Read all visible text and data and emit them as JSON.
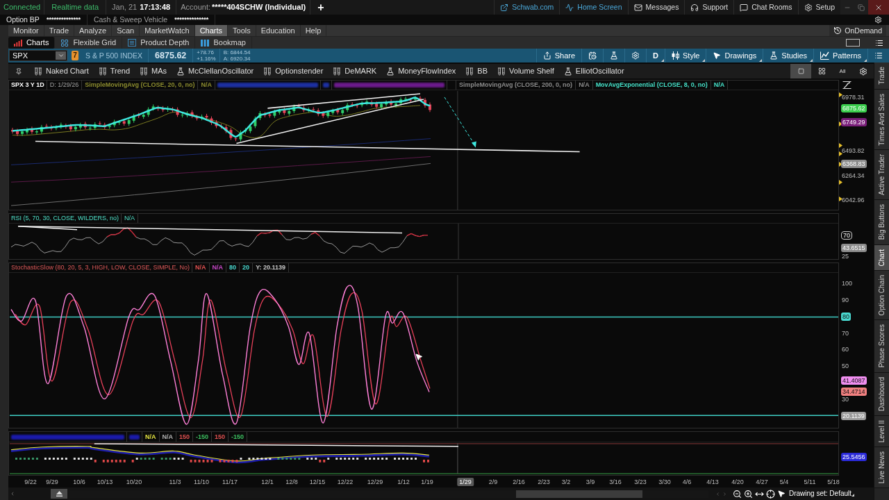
{
  "status_bar": {
    "connection": "Connected",
    "data_feed": "Realtime data",
    "date": "Jan, 21",
    "time": "17:13:48",
    "account_label": "Account:",
    "account": "*****404SCHW (Individual)",
    "add": "+",
    "links": [
      {
        "kind": "external",
        "label": "Schwab.com"
      },
      {
        "kind": "home",
        "label": "Home Screen"
      },
      {
        "kind": "mail",
        "label": "Messages"
      },
      {
        "kind": "support",
        "label": "Support"
      },
      {
        "kind": "chat",
        "label": "Chat Rooms"
      },
      {
        "kind": "setup",
        "label": "Setup"
      }
    ]
  },
  "balances": [
    {
      "label": "Option BP",
      "value": "**************"
    },
    {
      "label": "Cash & Sweep Vehicle",
      "value": "**************"
    }
  ],
  "main_tabs": [
    {
      "label": "Monitor",
      "selected": false
    },
    {
      "label": "Trade",
      "selected": false
    },
    {
      "label": "Analyze",
      "selected": false
    },
    {
      "label": "Scan",
      "selected": false
    },
    {
      "label": "MarketWatch",
      "selected": false
    },
    {
      "label": "Charts",
      "selected": true
    },
    {
      "label": "Tools",
      "selected": false
    },
    {
      "label": "Education",
      "selected": false
    },
    {
      "label": "Help",
      "selected": false
    }
  ],
  "on_demand": "OnDemand",
  "sub_tabs": [
    {
      "kind": "charts",
      "label": "Charts",
      "selected": true
    },
    {
      "kind": "grid",
      "label": "Flexible Grid",
      "selected": false
    },
    {
      "kind": "depth",
      "label": "Product Depth",
      "selected": false
    },
    {
      "kind": "bookmap",
      "label": "Bookmap",
      "selected": false
    }
  ],
  "quote": {
    "symbol": "SPX",
    "alerts": "7",
    "name": "S & P 500 INDEX",
    "last": "6875.62",
    "change": "+78.76",
    "change_percent": "+1.16%",
    "bid": "B: 6844.54",
    "ask": "A: 6920.34"
  },
  "chart_toolbar": [
    {
      "kind": "share",
      "label": "Share"
    },
    {
      "kind": "calendar"
    },
    {
      "kind": "flask"
    },
    {
      "kind": "gear"
    },
    {
      "kind": "text",
      "label": "D"
    },
    {
      "kind": "style",
      "label": "Style"
    },
    {
      "kind": "drawings",
      "label": "Drawings"
    },
    {
      "kind": "studies",
      "label": "Studies"
    },
    {
      "kind": "patterns",
      "label": "Patterns"
    },
    {
      "kind": "menu"
    }
  ],
  "study_sets": [
    {
      "kind": "pin"
    },
    {
      "kind": "tubes",
      "label": "Naked Chart"
    },
    {
      "kind": "tubes",
      "label": "Trend"
    },
    {
      "kind": "tubes",
      "label": "MAs"
    },
    {
      "kind": "flask",
      "label": "McClellanOscillator"
    },
    {
      "kind": "tubes",
      "label": "Optionstender"
    },
    {
      "kind": "tubes",
      "label": "DeMARK"
    },
    {
      "kind": "flask",
      "label": "MoneyFlowIndex"
    },
    {
      "kind": "tubes",
      "label": "BB"
    },
    {
      "kind": "tubes",
      "label": "Volume Shelf"
    },
    {
      "kind": "flask",
      "label": "ElliotOscillator"
    }
  ],
  "layout_buttons": [
    {
      "kind": "single",
      "selected": true
    },
    {
      "kind": "grid",
      "selected": false
    },
    {
      "kind": "all",
      "label": "All",
      "selected": false
    },
    {
      "kind": "settings",
      "selected": false
    }
  ],
  "chart": {
    "title": "SPX 3 Y 1D",
    "date": "D: 1/29/26",
    "studies": [
      {
        "kind": "study",
        "label": "SimpleMovingAvg (CLOSE, 20, 0, no)",
        "value": "N/A",
        "color": "#8c8c2e"
      },
      {
        "kind": "blurred",
        "color": "#1c2fa0"
      },
      {
        "kind": "blurred",
        "color": "#1c2fa0"
      },
      {
        "kind": "blurred",
        "color": "#6a1a8a"
      },
      {
        "kind": "study",
        "label": "SimpleMovingAvg (CLOSE, 200, 0, no)",
        "value": "N/A",
        "color": "#8a8a8a"
      },
      {
        "kind": "study",
        "label": "MovAvgExponential (CLOSE, 8, 0, no)",
        "value": "N/A",
        "color": "#45e0c8"
      }
    ],
    "axis": [
      {
        "text": "6978.31",
        "kind": "plain"
      },
      {
        "text": "6875.62",
        "kind": "badge",
        "color": "#3ccf4e"
      },
      {
        "text": "6749.29",
        "kind": "badge",
        "color": "#7a1f7a"
      },
      {
        "text": "6493.82",
        "kind": "plain"
      },
      {
        "text": "6368.83",
        "kind": "badge",
        "color": "#8c8c8c"
      },
      {
        "text": "6264.34",
        "kind": "plain"
      },
      {
        "text": "6042.96",
        "kind": "plain"
      }
    ]
  },
  "rsi": {
    "label": "RSI (5, 70, 30, CLOSE, WILDERS, no)",
    "value": "N/A",
    "axis": [
      {
        "text": "70",
        "kind": "outlined"
      },
      {
        "text": "43.6515",
        "kind": "badge",
        "color": "#8c8c8c"
      },
      {
        "text": "25",
        "kind": "plain"
      }
    ]
  },
  "stochastic": {
    "label": "StochasticSlow (80, 20, 5, 3, HIGH, LOW, CLOSE, SIMPLE, No)",
    "values": [
      {
        "text": "N/A",
        "color": "#e05050"
      },
      {
        "text": "N/A",
        "color": "#c848c8"
      },
      {
        "text": "80",
        "color": "#49d9d0"
      },
      {
        "text": "20",
        "color": "#49d9d0"
      },
      {
        "text": "Y: 20.1139",
        "color": "#c8c8c8"
      }
    ],
    "axis": [
      {
        "text": "100",
        "kind": "plain"
      },
      {
        "text": "90",
        "kind": "plain"
      },
      {
        "text": "80",
        "kind": "badge",
        "color": "#49d9d0"
      },
      {
        "text": "70",
        "kind": "plain"
      },
      {
        "text": "60",
        "kind": "plain"
      },
      {
        "text": "50",
        "kind": "plain"
      },
      {
        "text": "41.4087",
        "kind": "badge",
        "color": "#f08ef0"
      },
      {
        "text": "34.4714",
        "kind": "badge",
        "color": "#f08080"
      },
      {
        "text": "30",
        "kind": "plain"
      },
      {
        "text": "20.1139",
        "kind": "badge",
        "color": "#9a9a9a"
      }
    ]
  },
  "oscillator": {
    "values": [
      {
        "kind": "blurred",
        "color": "#1a1aa8"
      },
      {
        "kind": "blurred",
        "color": "#1a1aa8"
      },
      {
        "kind": "value",
        "text": "N/A",
        "color": "#e0e040"
      },
      {
        "kind": "value",
        "text": "N/A",
        "color": "#b0b0b0"
      },
      {
        "kind": "value",
        "text": "150",
        "color": "#e05050"
      },
      {
        "kind": "value",
        "text": "-150",
        "color": "#3cc060"
      },
      {
        "kind": "value",
        "text": "150",
        "color": "#e05050"
      },
      {
        "kind": "value",
        "text": "-150",
        "color": "#3cc060"
      }
    ],
    "axis": [
      {
        "text": "25.5456",
        "kind": "badge",
        "color": "#2a2ad8"
      }
    ]
  },
  "time_axis": [
    {
      "text": "9/22",
      "kind": "date"
    },
    {
      "text": "9/29",
      "kind": "date"
    },
    {
      "text": "10/6",
      "kind": "date"
    },
    {
      "text": "10/13",
      "kind": "date"
    },
    {
      "text": "10/20",
      "kind": "date"
    },
    {
      "text": "11/3",
      "kind": "date"
    },
    {
      "text": "11/10",
      "kind": "date"
    },
    {
      "text": "11/17",
      "kind": "date"
    },
    {
      "text": "12/1",
      "kind": "date"
    },
    {
      "text": "12/8",
      "kind": "date"
    },
    {
      "text": "12/15",
      "kind": "date"
    },
    {
      "text": "12/22",
      "kind": "date"
    },
    {
      "text": "12/29",
      "kind": "date"
    },
    {
      "text": "1/12",
      "kind": "date"
    },
    {
      "text": "1/19",
      "kind": "date"
    },
    {
      "text": "1/29",
      "kind": "cursor"
    },
    {
      "text": "2/9",
      "kind": "date"
    },
    {
      "text": "2/16",
      "kind": "date"
    },
    {
      "text": "2/23",
      "kind": "date"
    },
    {
      "text": "3/2",
      "kind": "date"
    },
    {
      "text": "3/9",
      "kind": "date"
    },
    {
      "text": "3/16",
      "kind": "date"
    },
    {
      "text": "3/23",
      "kind": "date"
    },
    {
      "text": "3/30",
      "kind": "date"
    },
    {
      "text": "4/6",
      "kind": "date"
    },
    {
      "text": "4/13",
      "kind": "date"
    },
    {
      "text": "4/20",
      "kind": "date"
    },
    {
      "text": "4/27",
      "kind": "date"
    },
    {
      "text": "5/4",
      "kind": "date"
    },
    {
      "text": "5/11",
      "kind": "date"
    },
    {
      "text": "5/18",
      "kind": "date"
    }
  ],
  "footer": {
    "drawing_set": "Drawing set: Default"
  },
  "side_tabs": [
    {
      "label": "Trade",
      "selected": false
    },
    {
      "label": "Times And Sales",
      "selected": false
    },
    {
      "label": "Active Trader",
      "selected": false
    },
    {
      "label": "Big Buttons",
      "selected": false
    },
    {
      "label": "Chart",
      "selected": true
    },
    {
      "label": "Option Chain",
      "selected": false
    },
    {
      "label": "Phase Scores",
      "selected": false
    },
    {
      "label": "Dashboard",
      "selected": false
    },
    {
      "label": "Level II",
      "selected": false
    },
    {
      "label": "Live News",
      "selected": false
    }
  ]
}
